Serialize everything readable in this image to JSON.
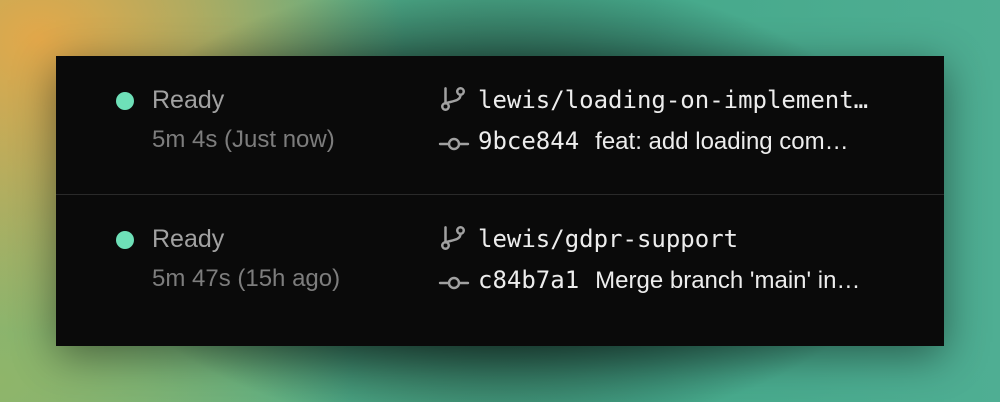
{
  "deployments": [
    {
      "status": "Ready",
      "duration": "5m 4s (Just now)",
      "branch": "lewis/loading-on-implement…",
      "commit_sha": "9bce844",
      "commit_message": "feat: add loading com…",
      "status_color": "#6ee0b8"
    },
    {
      "status": "Ready",
      "duration": "5m 47s (15h ago)",
      "branch": "lewis/gdpr-support",
      "commit_sha": "c84b7a1",
      "commit_message": "Merge branch 'main' in…",
      "status_color": "#6ee0b8"
    }
  ],
  "icons": {
    "branch": "git-branch-icon",
    "commit": "git-commit-icon",
    "status": "status-dot-icon"
  }
}
